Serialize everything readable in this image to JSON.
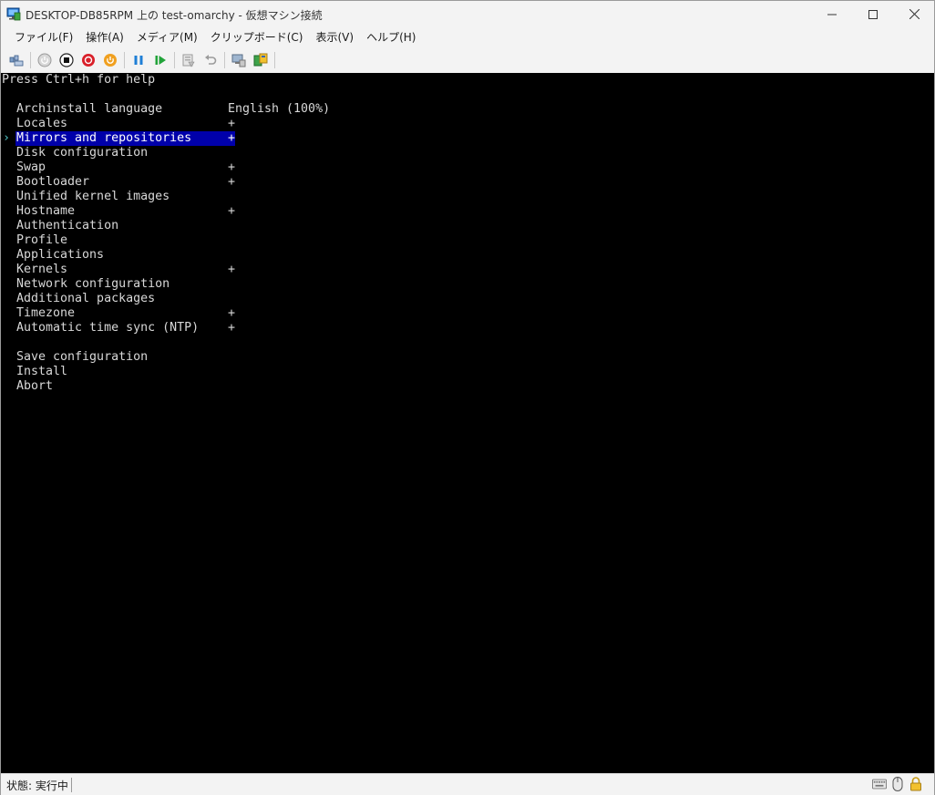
{
  "window": {
    "title": "DESKTOP-DB85RPM 上の test-omarchy  - 仮想マシン接続"
  },
  "menu": [
    {
      "label": "ファイル(F)"
    },
    {
      "label": "操作(A)"
    },
    {
      "label": "メディア(M)"
    },
    {
      "label": "クリップボード(C)"
    },
    {
      "label": "表示(V)"
    },
    {
      "label": "ヘルプ(H)"
    }
  ],
  "toolbar": {
    "buttons": [
      {
        "icon": "ctrl-alt-del-icon"
      },
      {
        "icon": "start-icon"
      },
      {
        "icon": "turn-off-icon"
      },
      {
        "icon": "shut-down-icon"
      },
      {
        "icon": "save-state-icon"
      },
      {
        "icon": "pause-icon"
      },
      {
        "icon": "resume-icon"
      },
      {
        "icon": "checkpoint-icon"
      },
      {
        "icon": "revert-icon"
      },
      {
        "icon": "enhanced-session-icon"
      },
      {
        "icon": "share-icon"
      }
    ]
  },
  "console": {
    "help_line": "Press Ctrl+h for help",
    "selected_index": 2,
    "menu_options": [
      {
        "label": "Archinstall language",
        "value": "English (100%)",
        "plus": ""
      },
      {
        "label": "Locales",
        "value": "",
        "plus": "+"
      },
      {
        "label": "Mirrors and repositories",
        "value": "",
        "plus": "+"
      },
      {
        "label": "Disk configuration",
        "value": "",
        "plus": ""
      },
      {
        "label": "Swap",
        "value": "",
        "plus": "+"
      },
      {
        "label": "Bootloader",
        "value": "",
        "plus": "+"
      },
      {
        "label": "Unified kernel images",
        "value": "",
        "plus": ""
      },
      {
        "label": "Hostname",
        "value": "",
        "plus": "+"
      },
      {
        "label": "Authentication",
        "value": "",
        "plus": ""
      },
      {
        "label": "Profile",
        "value": "",
        "plus": ""
      },
      {
        "label": "Applications",
        "value": "",
        "plus": ""
      },
      {
        "label": "Kernels",
        "value": "",
        "plus": "+"
      },
      {
        "label": "Network configuration",
        "value": "",
        "plus": ""
      },
      {
        "label": "Additional packages",
        "value": "",
        "plus": ""
      },
      {
        "label": "Timezone",
        "value": "",
        "plus": "+"
      },
      {
        "label": "Automatic time sync (NTP)",
        "value": "",
        "plus": "+"
      }
    ],
    "actions": [
      {
        "label": "Save configuration"
      },
      {
        "label": "Install"
      },
      {
        "label": "Abort"
      }
    ],
    "colors": {
      "background": "#000000",
      "text": "#d8d8d8",
      "selection": "#0000aa",
      "cursor": "#4fc3c3"
    }
  },
  "status": {
    "text": "状態: 実行中"
  }
}
